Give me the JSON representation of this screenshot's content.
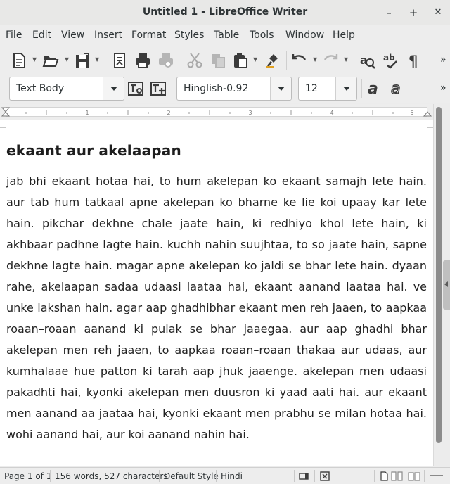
{
  "window": {
    "title": "Untitled 1 - LibreOffice Writer",
    "minimize": "–",
    "maximize": "+",
    "close": "✕"
  },
  "menu": [
    "File",
    "Edit",
    "View",
    "Insert",
    "Format",
    "Styles",
    "Table",
    "Tools",
    "Window",
    "Help"
  ],
  "toolbar1": {
    "icons": [
      "new-document-icon",
      "open-icon",
      "save-icon",
      "export-pdf-icon",
      "print-icon",
      "print-preview-icon",
      "cut-icon",
      "copy-icon",
      "paste-icon",
      "clone-formatting-icon",
      "undo-icon",
      "redo-icon",
      "find-replace-icon",
      "spelling-icon",
      "formatting-marks-icon"
    ],
    "overflow": "»"
  },
  "toolbar2": {
    "paragraph_style": "Text Body",
    "font_name": "Hinglish-0.92",
    "font_size": "12",
    "overflow": "»"
  },
  "document": {
    "heading": "ekaant aur akelaapan",
    "body": "jab bhi ekaant hotaa hai, to hum akelepan ko ekaant samajh lete hain. aur tab hum tatkaal apne akelepan ko bharne ke lie koi upaay kar lete hain. pikchar dekhne chale jaate hain, ki redhiyo khol lete hain, ki akhbaar padhne lagte hain. kuchh nahin suujhtaa, to so jaate hain, sapne dekhne lagte hain. magar apne akelepan ko jaldi se bhar lete hain. dyaan rahe, akelaapan sadaa udaasi laataa hai, ekaant aanand laataa hai. ve unke lakshan hain. agar aap ghadhibhar ekaant men reh jaaen, to aapkaa roaan–roaan aanand ki pulak se bhar jaaegaa. aur aap ghadhi bhar akelepan men reh jaaen, to aapkaa roaan–roaan thakaa aur udaas, aur kumhalaae hue patton ki tarah aap jhuk jaaenge. akelepan men udaasi pakadhti hai, kyonki akelepan men duusron ki yaad aati hai. aur ekaant men aanand aa jaataa hai, kyonki ekaant men prabhu se milan hotaa hai. wohi aanand hai, aur koi aanand nahin hai."
  },
  "statusbar": {
    "page": "Page 1 of 1",
    "counts": "156 words, 527 characters",
    "page_style": "Default Style",
    "language": "Hindi"
  }
}
